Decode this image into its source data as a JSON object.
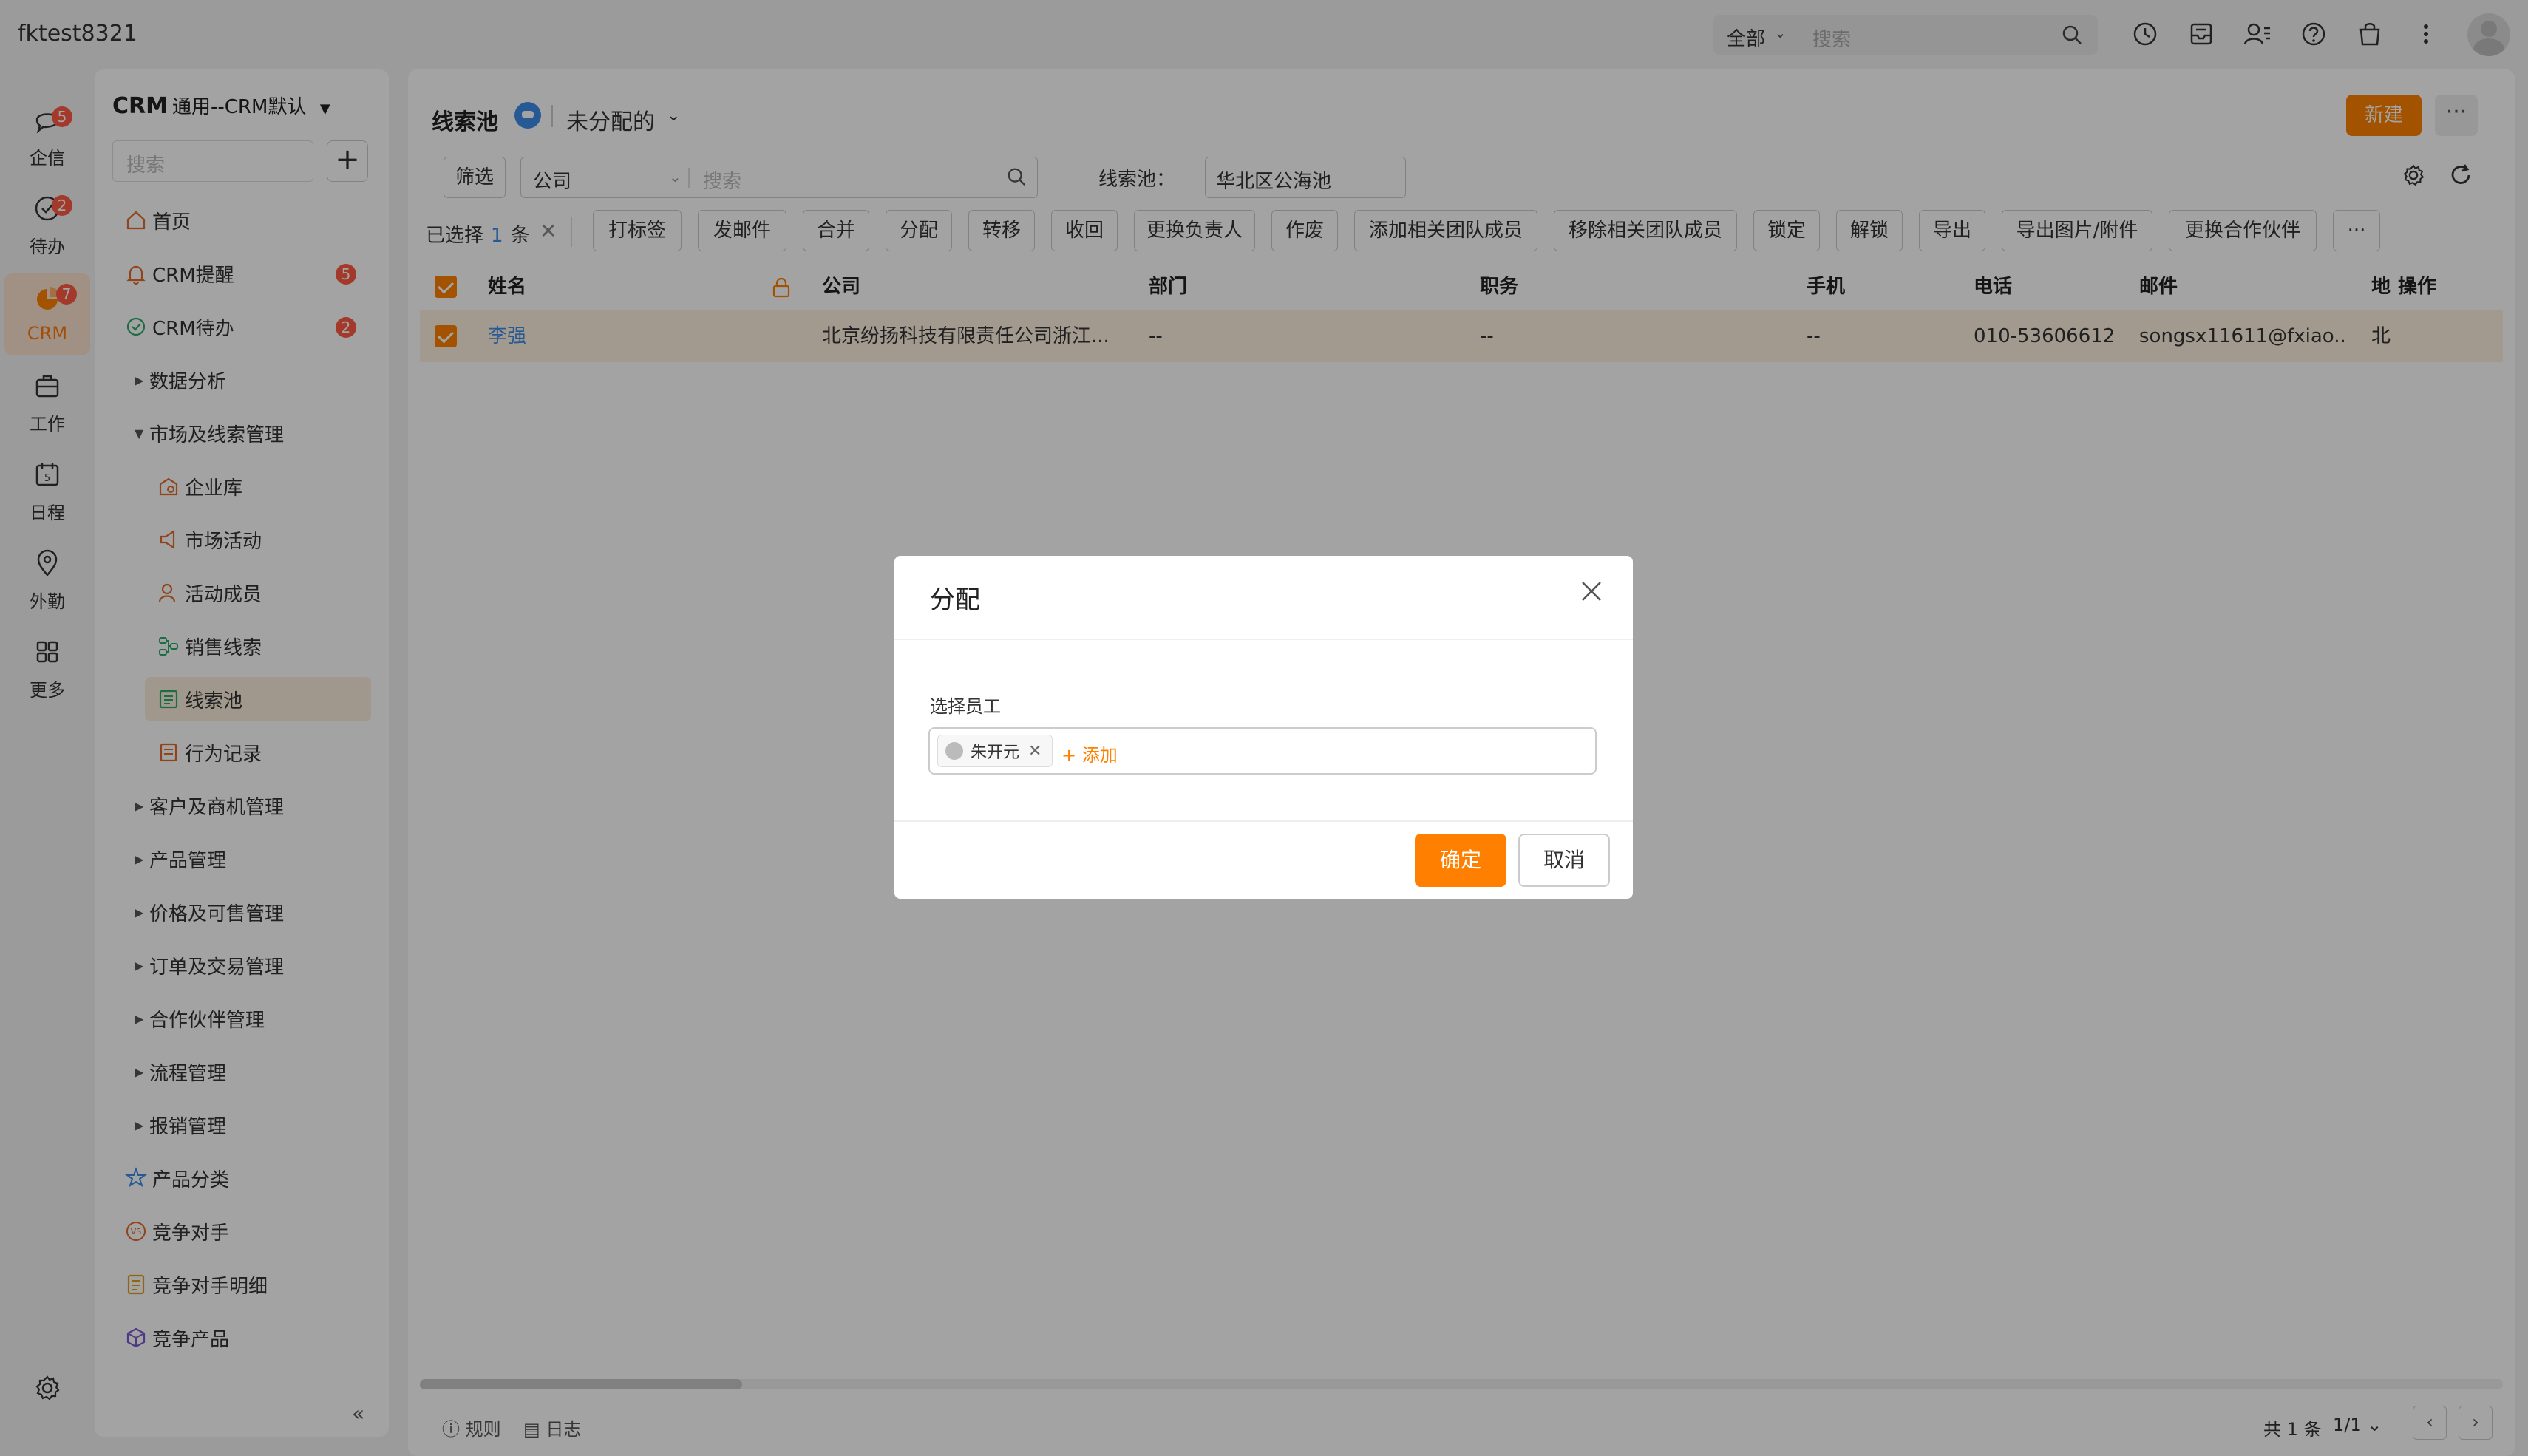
{
  "topbar": {
    "account": "fktest8321",
    "search_scope": "全部",
    "search_placeholder": "搜索"
  },
  "rail": {
    "items": [
      {
        "label": "企信",
        "badge": "5",
        "icon": "chat-icon"
      },
      {
        "label": "待办",
        "badge": "2",
        "icon": "check-circle-icon"
      },
      {
        "label": "CRM",
        "badge": "7",
        "icon": "crm-icon",
        "active": true
      },
      {
        "label": "工作",
        "icon": "briefcase-icon"
      },
      {
        "label": "日程",
        "icon": "calendar-icon"
      },
      {
        "label": "外勤",
        "icon": "location-pin-icon"
      },
      {
        "label": "更多",
        "icon": "grid-icon"
      }
    ]
  },
  "nav": {
    "title": "CRM",
    "subtitle": "通用--CRM默认",
    "search_placeholder": "搜索",
    "items": [
      {
        "label": "首页",
        "type": "top",
        "icon": "home-icon"
      },
      {
        "label": "CRM提醒",
        "type": "top",
        "count": "5",
        "icon": "bell-icon"
      },
      {
        "label": "CRM待办",
        "type": "top",
        "count": "2",
        "icon": "check-circle-icon"
      },
      {
        "label": "数据分析",
        "type": "group",
        "expanded": false
      },
      {
        "label": "市场及线索管理",
        "type": "group",
        "expanded": true
      },
      {
        "label": "企业库",
        "type": "sub",
        "icon": "building-icon"
      },
      {
        "label": "市场活动",
        "type": "sub",
        "icon": "megaphone-icon"
      },
      {
        "label": "活动成员",
        "type": "sub",
        "icon": "person-icon"
      },
      {
        "label": "销售线索",
        "type": "sub",
        "icon": "flow-icon"
      },
      {
        "label": "线索池",
        "type": "sub",
        "icon": "list-icon",
        "selected": true
      },
      {
        "label": "行为记录",
        "type": "sub",
        "icon": "record-icon"
      },
      {
        "label": "客户及商机管理",
        "type": "group",
        "expanded": false
      },
      {
        "label": "产品管理",
        "type": "group",
        "expanded": false
      },
      {
        "label": "价格及可售管理",
        "type": "group",
        "expanded": false
      },
      {
        "label": "订单及交易管理",
        "type": "group",
        "expanded": false
      },
      {
        "label": "合作伙伴管理",
        "type": "group",
        "expanded": false
      },
      {
        "label": "流程管理",
        "type": "group",
        "expanded": false
      },
      {
        "label": "报销管理",
        "type": "group",
        "expanded": false
      },
      {
        "label": "产品分类",
        "type": "top",
        "icon": "star-tag-icon"
      },
      {
        "label": "竞争对手",
        "type": "top",
        "icon": "vs-icon"
      },
      {
        "label": "竞争对手明细",
        "type": "top",
        "icon": "doc-icon"
      },
      {
        "label": "竞争产品",
        "type": "top",
        "icon": "box-icon"
      }
    ]
  },
  "main": {
    "title": "线索池",
    "view": "未分配的",
    "new_label": "新建",
    "more_label": "···",
    "filter_label": "筛选",
    "search_field": "公司",
    "search_placeholder": "搜索",
    "pool_label": "线索池：",
    "pool_value": "华北区公海池",
    "selected_prefix": "已选择",
    "selected_count": "1",
    "selected_suffix": "条",
    "actions": [
      "打标签",
      "发邮件",
      "合并",
      "分配",
      "转移",
      "收回",
      "更换负责人",
      "作废",
      "添加相关团队成员",
      "移除相关团队成员",
      "锁定",
      "解锁",
      "导出",
      "导出图片/附件",
      "更换合作伙伴"
    ],
    "actions_more": "···",
    "columns": [
      "姓名",
      "公司",
      "部门",
      "职务",
      "手机",
      "电话",
      "邮件",
      "地",
      "操作"
    ],
    "rows": [
      {
        "name": "李强",
        "company": "北京纷扬科技有限责任公司浙江...",
        "dept": "--",
        "title": "--",
        "mobile": "--",
        "phone": "010-53606612",
        "email": "songsx11611@fxiao...",
        "addr": "北"
      }
    ],
    "footer_rules": "规则",
    "footer_log": "日志",
    "total": "共 1 条",
    "page": "1/1"
  },
  "dialog": {
    "title": "分配",
    "field_label": "选择员工",
    "selected_employee": "朱开元",
    "add_label": "+ 添加",
    "ok_label": "确定",
    "cancel_label": "取消"
  },
  "colors": {
    "accent": "#ff8000",
    "link": "#3d8de8",
    "badge": "#ff5a43",
    "selected_row": "#fdf0e0"
  }
}
